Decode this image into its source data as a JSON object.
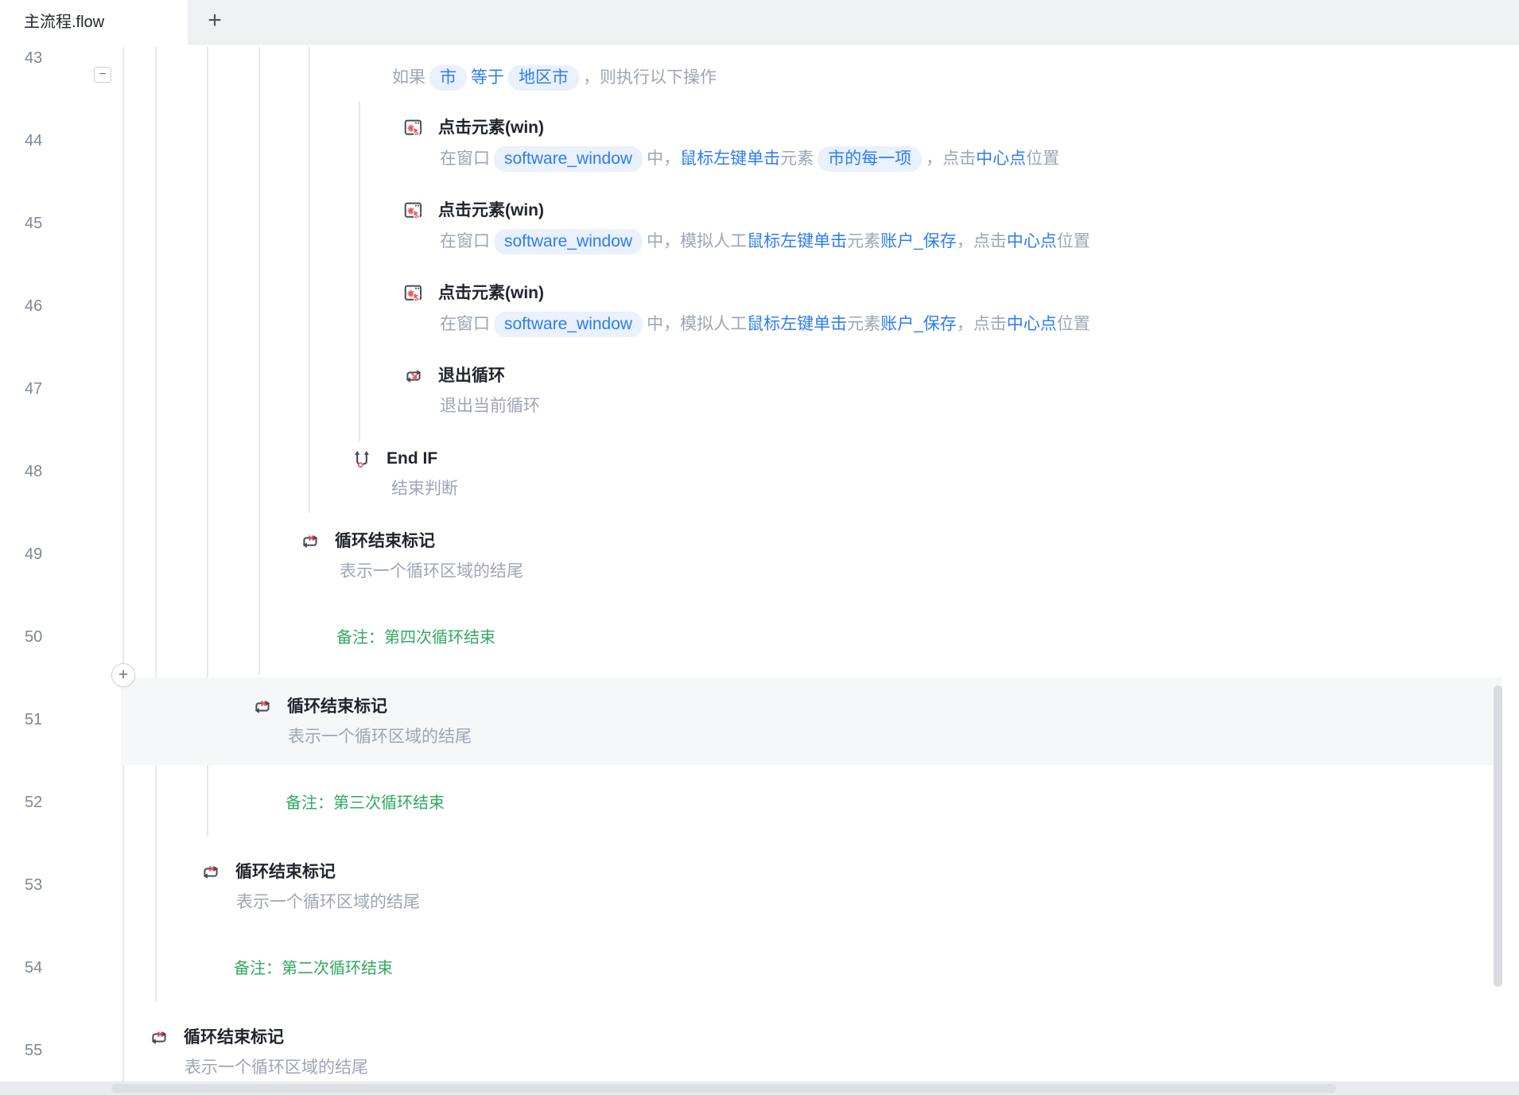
{
  "tab": {
    "title": "主流程.flow",
    "new_tab": "+"
  },
  "colors": {
    "accent_blue": "#2e7cf5",
    "pill_bg": "#e9f1fd",
    "note_green": "#31a95f",
    "icon_red": "#f05b5b",
    "icon_dark": "#454c5a",
    "highlight_row_bg": "#f5f7f9"
  },
  "controls": {
    "collapse": "−",
    "add_step": "+"
  },
  "row43": {
    "num": "43",
    "t1": "如果",
    "v1": "市",
    "op": "等于",
    "v2": "地区市",
    "t2": "，则执行以下操作"
  },
  "row44": {
    "num": "44",
    "title": "点击元素(win)",
    "d1": "在窗口",
    "win": "software_window",
    "d2": "中，",
    "d3": "鼠标左键单击",
    "d4": "元素",
    "el": "市的每一项",
    "d5": "，点击",
    "d6": "中心点",
    "d7": "位置"
  },
  "row45": {
    "num": "45",
    "title": "点击元素(win)",
    "d1": "在窗口",
    "win": "software_window",
    "d2": "中，模拟人工",
    "d3": "鼠标左键单击",
    "d4": "元素",
    "el": "账户_保存",
    "d5": "，点击",
    "d6": "中心点",
    "d7": "位置"
  },
  "row46": {
    "num": "46",
    "title": "点击元素(win)",
    "d1": "在窗口",
    "win": "software_window",
    "d2": "中，模拟人工",
    "d3": "鼠标左键单击",
    "d4": "元素",
    "el": "账户_保存",
    "d5": "，点击",
    "d6": "中心点",
    "d7": "位置"
  },
  "row47": {
    "num": "47",
    "title": "退出循环",
    "desc": "退出当前循环"
  },
  "row48": {
    "num": "48",
    "title": "End IF",
    "desc": "结束判断"
  },
  "row49": {
    "num": "49",
    "title": "循环结束标记",
    "desc": "表示一个循环区域的结尾"
  },
  "note50": {
    "num": "50",
    "text": "备注：第四次循环结束"
  },
  "row51": {
    "num": "51",
    "title": "循环结束标记",
    "desc": "表示一个循环区域的结尾"
  },
  "note52": {
    "num": "52",
    "text": "备注：第三次循环结束"
  },
  "row53": {
    "num": "53",
    "title": "循环结束标记",
    "desc": "表示一个循环区域的结尾"
  },
  "note54": {
    "num": "54",
    "text": "备注：第二次循环结束"
  },
  "row55": {
    "num": "55",
    "title": "循环结束标记",
    "desc": "表示一个循环区域的结尾"
  }
}
